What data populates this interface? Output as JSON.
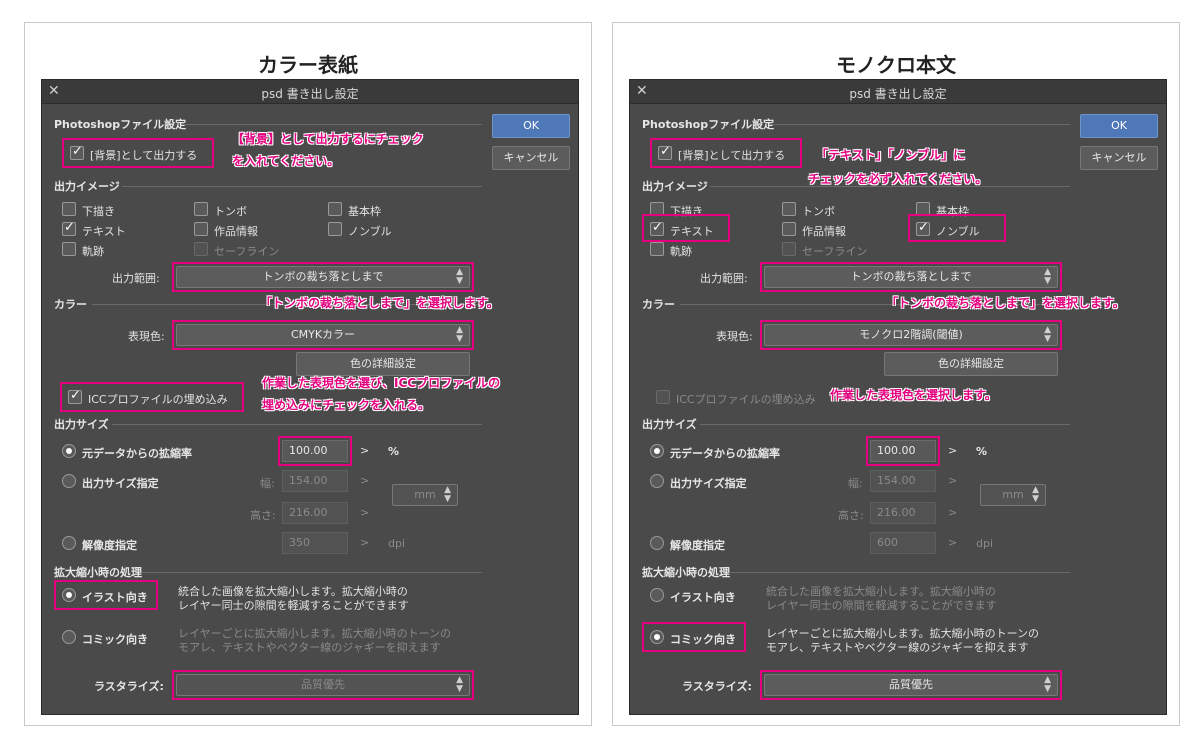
{
  "panels": [
    {
      "title": "カラー表紙",
      "dialog": {
        "title": "psd 書き出し設定",
        "section_photoshop": "Photoshopファイル設定",
        "bg_output": "[背景]として出力する",
        "ok": "OK",
        "cancel": "キャンセル",
        "section_output_image": "出力イメージ",
        "cb_shitagaki": "下描き",
        "cb_tonbo": "トンボ",
        "cb_kihonwaku": "基本枠",
        "cb_text": "テキスト",
        "cb_sakuhin": "作品情報",
        "cb_nombre": "ノンブル",
        "cb_kiseki": "軌跡",
        "cb_safeline": "セーフライン",
        "range_label": "出力範囲:",
        "range_value": "トンボの裁ち落としまで",
        "section_color": "カラー",
        "color_label": "表現色:",
        "color_value": "CMYKカラー",
        "color_detail": "色の詳細設定",
        "icc": "ICCプロファイルの埋め込み",
        "section_size": "出力サイズ",
        "rb_scale": "元データからの拡縮率",
        "scale_value": "100.00",
        "scale_unit": "%",
        "rb_size": "出力サイズ指定",
        "width_label": "幅:",
        "width_value": "154.00",
        "height_label": "高さ:",
        "height_value": "216.00",
        "unit_value": "mm",
        "rb_dpi": "解像度指定",
        "dpi_value": "350",
        "dpi_unit": "dpi",
        "section_scale_proc": "拡大縮小時の処理",
        "rb_illust": "イラスト向き",
        "illust_desc1": "統合した画像を拡大縮小します。拡大縮小時の",
        "illust_desc2": "レイヤー同士の隙間を軽減することができます",
        "rb_comic": "コミック向き",
        "comic_desc1": "レイヤーごとに拡大縮小します。拡大縮小時のトーンの",
        "comic_desc2": "モアレ、テキストやベクター線のジャギーを抑えます",
        "raster_label": "ラスタライズ:",
        "raster_value": "品質優先"
      },
      "notes": {
        "n1a": "【背景】として出力するにチェック",
        "n1b": "を入れてください。",
        "n2": "「トンボの裁ち落としまで」を選択します。",
        "n3a": "作業した表現色を選び、ICCプロファイルの",
        "n3b": "埋め込みにチェックを入れる。"
      }
    },
    {
      "title": "モノクロ本文",
      "dialog": {
        "title": "psd 書き出し設定",
        "section_photoshop": "Photoshopファイル設定",
        "bg_output": "[背景]として出力する",
        "ok": "OK",
        "cancel": "キャンセル",
        "section_output_image": "出力イメージ",
        "cb_shitagaki": "下描き",
        "cb_tonbo": "トンボ",
        "cb_kihonwaku": "基本枠",
        "cb_text": "テキスト",
        "cb_sakuhin": "作品情報",
        "cb_nombre": "ノンブル",
        "cb_kiseki": "軌跡",
        "cb_safeline": "セーフライン",
        "range_label": "出力範囲:",
        "range_value": "トンボの裁ち落としまで",
        "section_color": "カラー",
        "color_label": "表現色:",
        "color_value": "モノクロ2階調(閾値)",
        "color_detail": "色の詳細設定",
        "icc": "ICCプロファイルの埋め込み",
        "section_size": "出力サイズ",
        "rb_scale": "元データからの拡縮率",
        "scale_value": "100.00",
        "scale_unit": "%",
        "rb_size": "出力サイズ指定",
        "width_label": "幅:",
        "width_value": "154.00",
        "height_label": "高さ:",
        "height_value": "216.00",
        "unit_value": "mm",
        "rb_dpi": "解像度指定",
        "dpi_value": "600",
        "dpi_unit": "dpi",
        "section_scale_proc": "拡大縮小時の処理",
        "rb_illust": "イラスト向き",
        "illust_desc1": "統合した画像を拡大縮小します。拡大縮小時の",
        "illust_desc2": "レイヤー同士の隙間を軽減することができます",
        "rb_comic": "コミック向き",
        "comic_desc1": "レイヤーごとに拡大縮小します。拡大縮小時のトーンの",
        "comic_desc2": "モアレ、テキストやベクター線のジャギーを抑えます",
        "raster_label": "ラスタライズ:",
        "raster_value": "品質優先"
      },
      "notes": {
        "n1a": "「テキスト」「ノンブル」に",
        "n1b": "チェックを必ず入れてください。",
        "n2": "「トンボの裁ち落としまで」を選択します。",
        "n3": "作業した表現色を選択します。"
      }
    }
  ],
  "colors": {
    "highlight": "#e4007f",
    "dialog_bg": "#4a4a4a",
    "ok_button": "#4f78b8"
  }
}
